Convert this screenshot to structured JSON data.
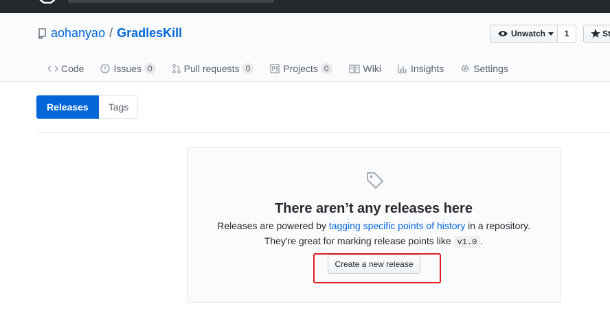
{
  "repo": {
    "owner": "aohanyao",
    "separator": "/",
    "name": "GradlesKill"
  },
  "actions": {
    "watch_label": "Unwatch",
    "watch_count": "1",
    "star_label": "St"
  },
  "tabs": [
    {
      "label": "Code",
      "icon": "code-icon",
      "count": ""
    },
    {
      "label": "Issues",
      "icon": "issue-icon",
      "count": "0"
    },
    {
      "label": "Pull requests",
      "icon": "pull-request-icon",
      "count": "0"
    },
    {
      "label": "Projects",
      "icon": "project-icon",
      "count": "0"
    },
    {
      "label": "Wiki",
      "icon": "book-icon",
      "count": ""
    },
    {
      "label": "Insights",
      "icon": "graph-icon",
      "count": ""
    },
    {
      "label": "Settings",
      "icon": "gear-icon",
      "count": ""
    }
  ],
  "subnav": {
    "releases": "Releases",
    "tags": "Tags"
  },
  "blankslate": {
    "title": "There aren’t any releases here",
    "line1_prefix": "Releases are powered by",
    "line1_link": "tagging specific points of history",
    "line1_suffix": "in a repository.",
    "line2_prefix": "They're great for marking release points like",
    "line2_code": "v1.0",
    "line2_suffix": ".",
    "button": "Create a new release"
  },
  "colors": {
    "accent": "#0366d6",
    "highlight": "#e01e1e",
    "topbar": "#24292e"
  }
}
